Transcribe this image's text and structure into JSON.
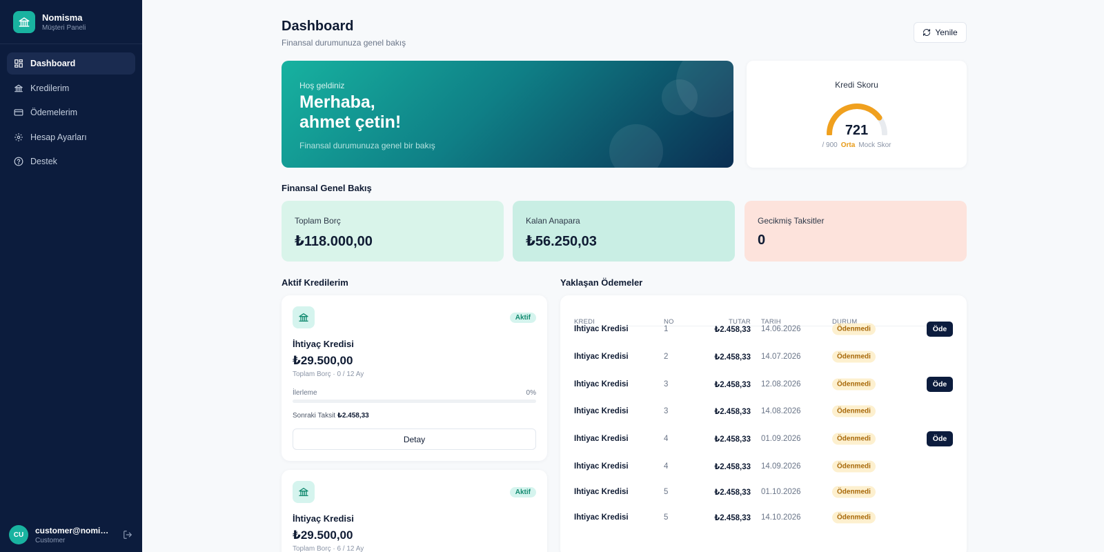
{
  "brand": {
    "name": "Nomisma",
    "subtitle": "Müşteri Paneli"
  },
  "nav": [
    {
      "label": "Dashboard",
      "icon": "grid-icon",
      "active": true
    },
    {
      "label": "Kredilerim",
      "icon": "bank-icon",
      "active": false
    },
    {
      "label": "Ödemelerim",
      "icon": "credit-card-icon",
      "active": false
    },
    {
      "label": "Hesap Ayarları",
      "icon": "gear-icon",
      "active": false
    },
    {
      "label": "Destek",
      "icon": "help-circle-icon",
      "active": false
    }
  ],
  "user": {
    "initials": "CU",
    "email": "customer@nomisma.com",
    "role": "Customer"
  },
  "header": {
    "title": "Dashboard",
    "subtitle": "Finansal durumunuza genel bakış",
    "refresh_label": "Yenile"
  },
  "hero": {
    "greeting": "Hoş geldiniz",
    "name_line1": "Merhaba,",
    "name_line2": "ahmet çetin!",
    "subtitle": "Finansal durumunuza genel bir bakış"
  },
  "credit_score": {
    "title": "Kredi Skoru",
    "score": "721",
    "max": "/ 900",
    "level": "Orta",
    "source": "Mock Skor",
    "fraction": 0.8011,
    "color": "#f0a01e"
  },
  "overview": {
    "title": "Finansal Genel Bakış",
    "cards": [
      {
        "label": "Toplam Borç",
        "value": "₺118.000,00",
        "bg": "#d9f4ea"
      },
      {
        "label": "Kalan Anapara",
        "value": "₺56.250,03",
        "bg": "#c9eee4"
      },
      {
        "label": "Gecikmiş Taksitler",
        "value": "0",
        "bg": "#fde3dc"
      }
    ]
  },
  "active_loans": {
    "title": "Aktif Kredilerim",
    "items": [
      {
        "badge": "Aktif",
        "name": "İhtiyaç Kredisi",
        "amount": "₺29.500,00",
        "meta": "Toplam Borç · 0 / 12 Ay",
        "progress_label": "İlerleme",
        "progress_pct": "0%",
        "progress": 0,
        "next_label": "Sonraki Taksit",
        "next_value": "₺2.458,33",
        "detail_label": "Detay"
      },
      {
        "badge": "Aktif",
        "name": "İhtiyaç Kredisi",
        "amount": "₺29.500,00",
        "meta": "Toplam Borç · 6 / 12 Ay"
      }
    ]
  },
  "upcoming": {
    "title": "Yaklaşan Ödemeler",
    "headers": {
      "kredi": "KREDI",
      "no": "NO",
      "tutar": "TUTAR",
      "tarih": "TARIH",
      "durum": "DURUM"
    },
    "rows": [
      {
        "kredi": "Ihtiyac Kredisi",
        "no": "1",
        "tutar": "₺2.458,33",
        "tarih": "14.06.2026",
        "durum": "Ödenmedi",
        "pay": "Öde"
      },
      {
        "kredi": "Ihtiyac Kredisi",
        "no": "2",
        "tutar": "₺2.458,33",
        "tarih": "14.07.2026",
        "durum": "Ödenmedi",
        "pay": ""
      },
      {
        "kredi": "Ihtiyac Kredisi",
        "no": "3",
        "tutar": "₺2.458,33",
        "tarih": "12.08.2026",
        "durum": "Ödenmedi",
        "pay": "Öde"
      },
      {
        "kredi": "Ihtiyac Kredisi",
        "no": "3",
        "tutar": "₺2.458,33",
        "tarih": "14.08.2026",
        "durum": "Ödenmedi",
        "pay": ""
      },
      {
        "kredi": "Ihtiyac Kredisi",
        "no": "4",
        "tutar": "₺2.458,33",
        "tarih": "01.09.2026",
        "durum": "Ödenmedi",
        "pay": "Öde"
      },
      {
        "kredi": "Ihtiyac Kredisi",
        "no": "4",
        "tutar": "₺2.458,33",
        "tarih": "14.09.2026",
        "durum": "Ödenmedi",
        "pay": ""
      },
      {
        "kredi": "Ihtiyac Kredisi",
        "no": "5",
        "tutar": "₺2.458,33",
        "tarih": "01.10.2026",
        "durum": "Ödenmedi",
        "pay": ""
      },
      {
        "kredi": "Ihtiyac Kredisi",
        "no": "5",
        "tutar": "₺2.458,33",
        "tarih": "14.10.2026",
        "durum": "Ödenmedi",
        "pay": ""
      }
    ]
  }
}
